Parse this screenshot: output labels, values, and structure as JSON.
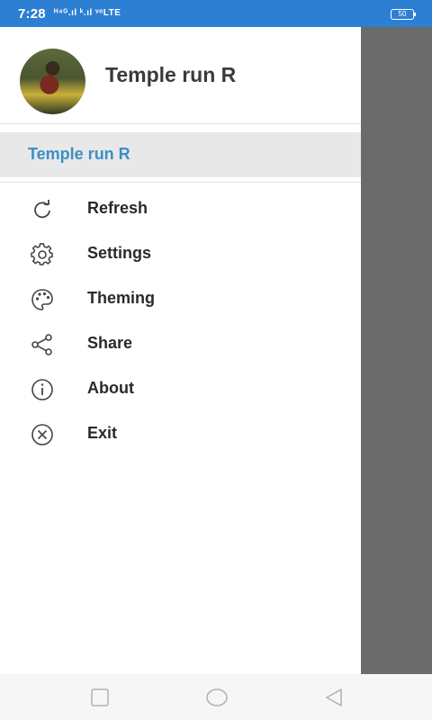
{
  "status_bar": {
    "time": "7:28",
    "signal_text": "ᴴ⁴ᴳ.ıl ᵏ.ıl ᵛᵒLTE",
    "battery": "50"
  },
  "drawer": {
    "header_title": "Temple run R",
    "selected_item": "Temple run R",
    "menu": [
      {
        "label": "Refresh",
        "icon": "refresh-icon"
      },
      {
        "label": "Settings",
        "icon": "gear-icon"
      },
      {
        "label": "Theming",
        "icon": "palette-icon"
      },
      {
        "label": "Share",
        "icon": "share-icon"
      },
      {
        "label": "About",
        "icon": "info-icon"
      },
      {
        "label": "Exit",
        "icon": "close-circle-icon"
      }
    ]
  },
  "nav_bar": {
    "buttons": [
      "recents-square-icon",
      "home-circle-icon",
      "back-triangle-icon"
    ]
  },
  "colors": {
    "status_bar": "#2d7fd4",
    "accent": "#3b8fc4",
    "scrim": "#6b6b6b"
  }
}
